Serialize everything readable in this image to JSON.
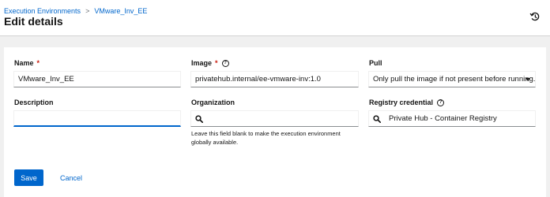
{
  "header": {
    "breadcrumb": [
      {
        "label": "Execution Environments"
      },
      {
        "label": "VMware_Inv_EE"
      }
    ],
    "breadcrumb_separator": ">",
    "title": "Edit details",
    "history_icon": "history-icon"
  },
  "form": {
    "name": {
      "label": "Name",
      "required_mark": "*",
      "value": "VMware_Inv_EE"
    },
    "image": {
      "label": "Image",
      "required_mark": "*",
      "help_icon": "?",
      "value": "privatehub.internal/ee-vmware-inv:1.0"
    },
    "pull": {
      "label": "Pull",
      "value": "Only pull the image if not present before running."
    },
    "description": {
      "label": "Description",
      "value": ""
    },
    "organization": {
      "label": "Organization",
      "value": "",
      "helper_text": "Leave this field blank to make the execution environment globally available."
    },
    "registry_credential": {
      "label": "Registry credential",
      "help_icon": "?",
      "value": "Private Hub - Container Registry"
    }
  },
  "actions": {
    "save_label": "Save",
    "cancel_label": "Cancel"
  },
  "colors": {
    "link": "#0066cc",
    "primary_button": "#0066cc",
    "required": "#c9190b",
    "page_background": "#f0f0f0"
  }
}
